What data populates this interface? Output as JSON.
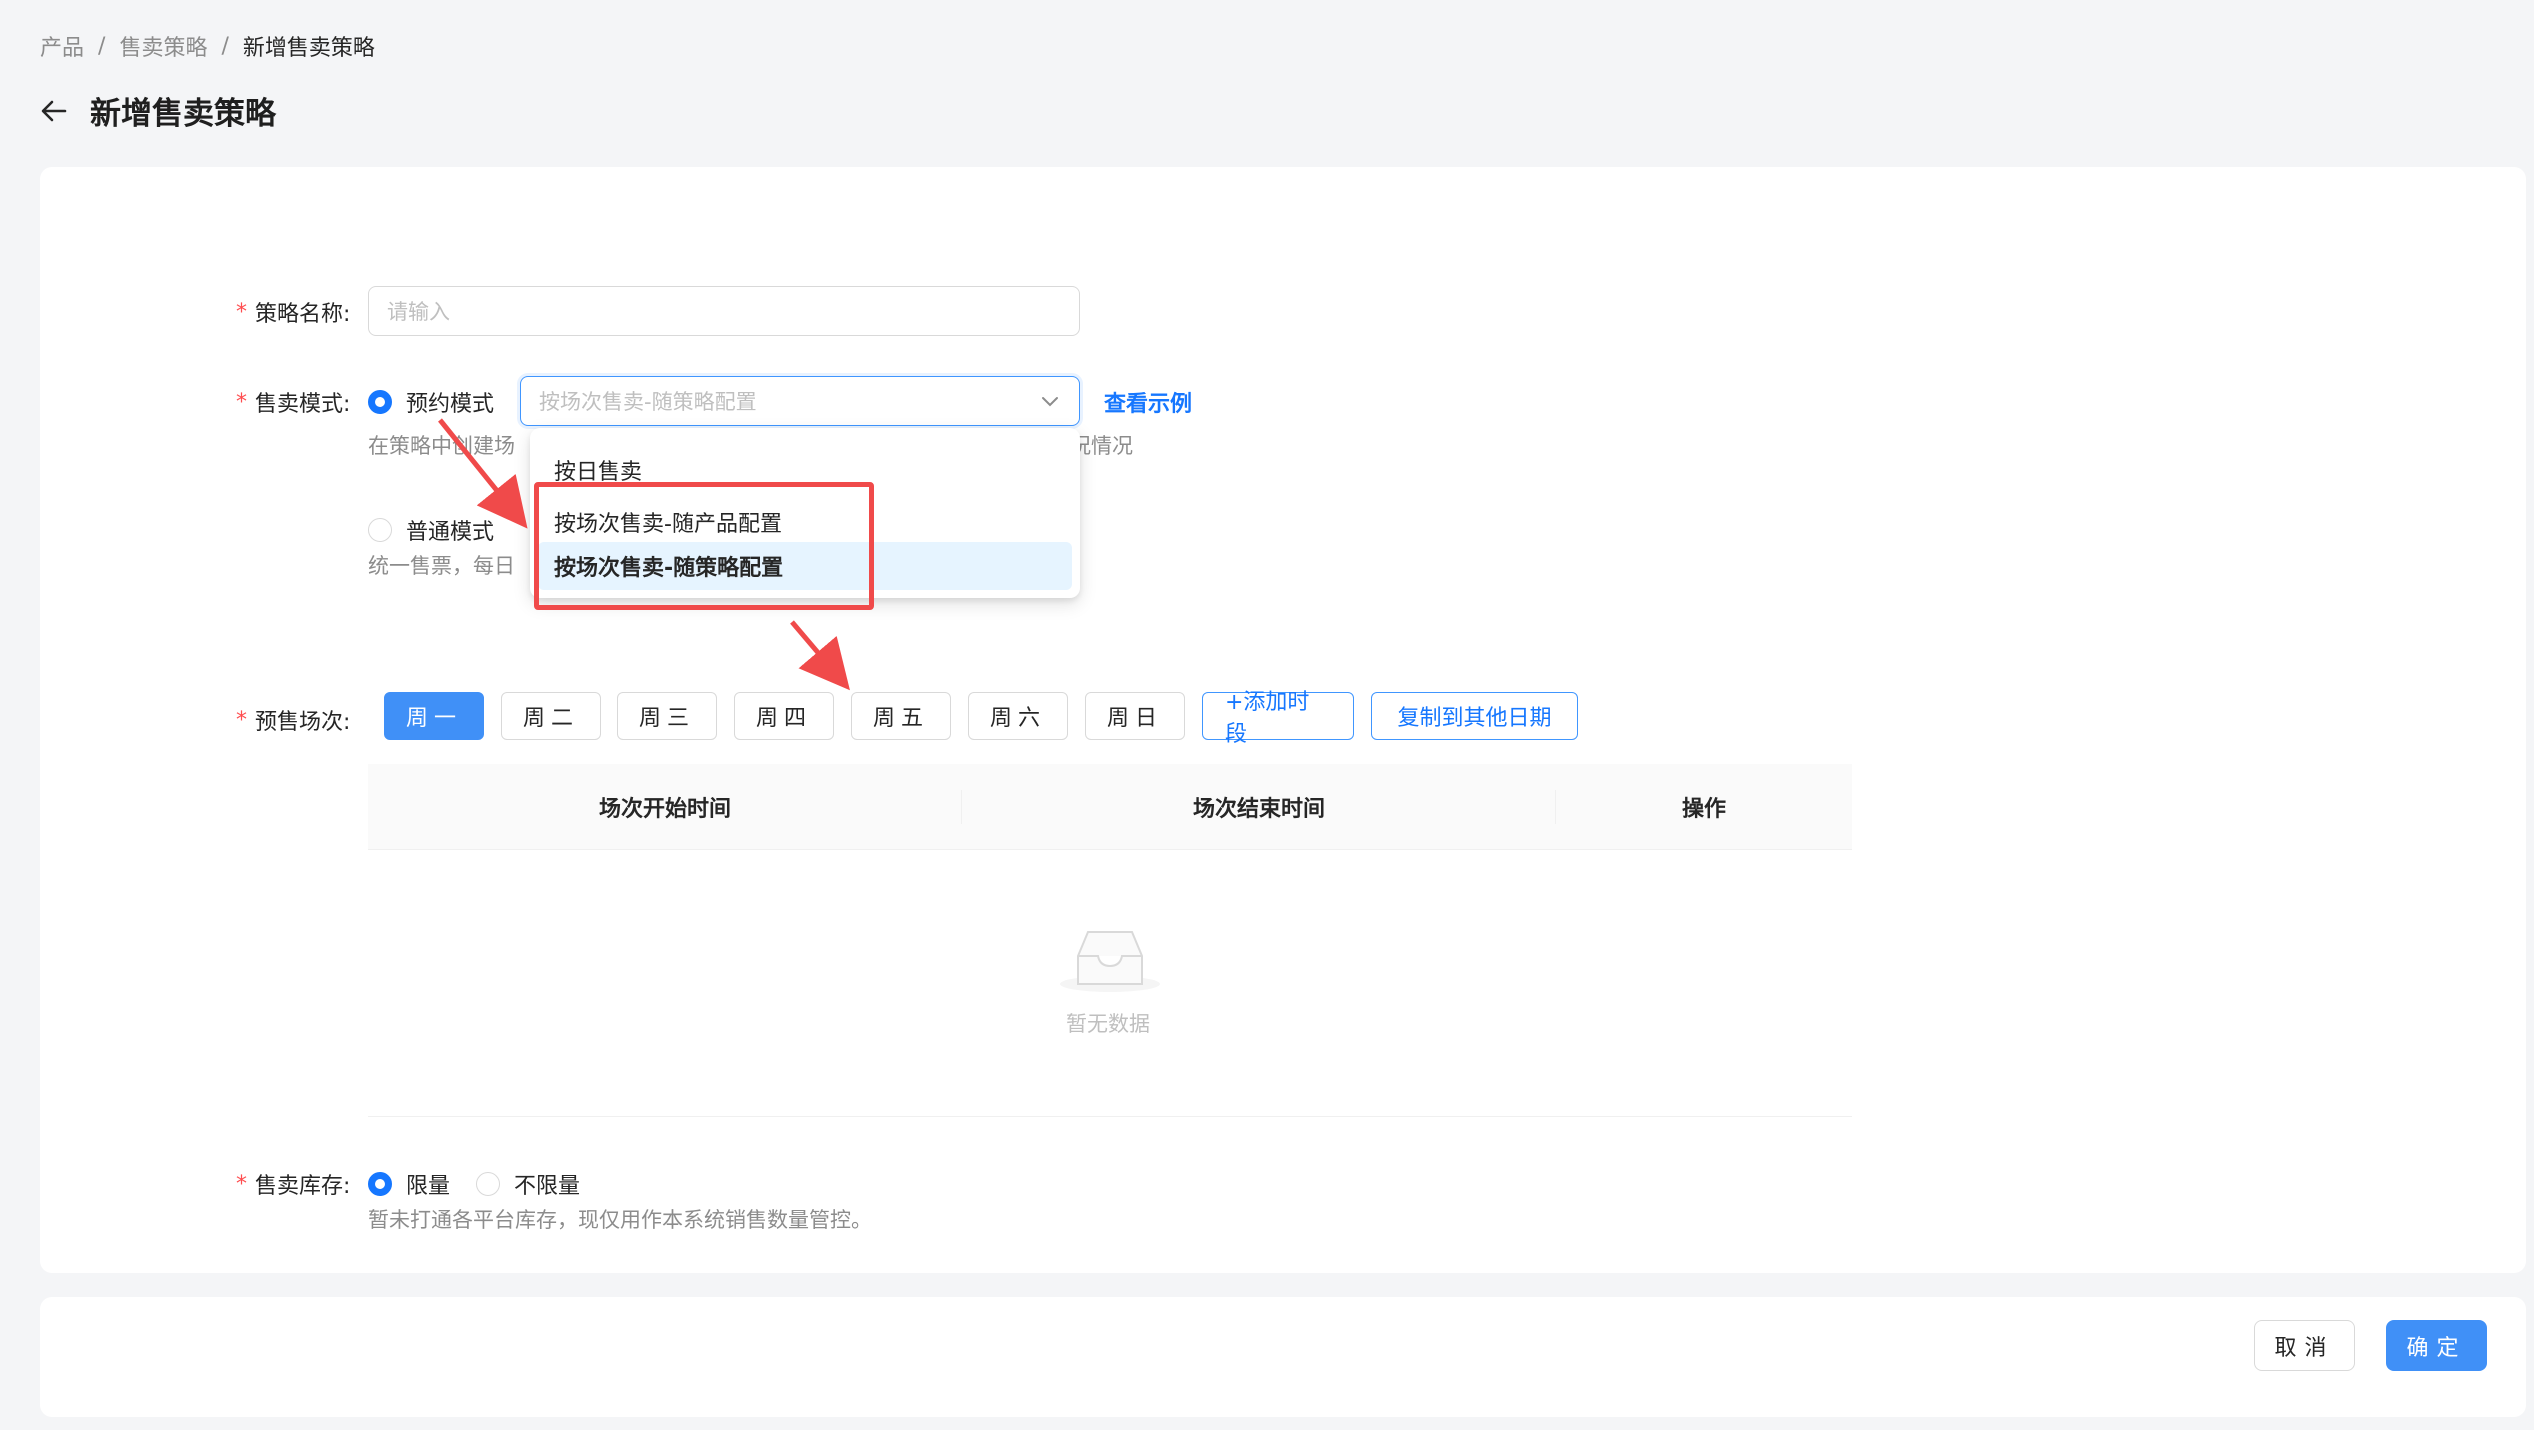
{
  "breadcrumb": {
    "item1": "产品",
    "item2": "售卖策略",
    "current": "新增售卖策略",
    "separator": "/"
  },
  "page": {
    "title": "新增售卖策略"
  },
  "form": {
    "required_mark": "*",
    "strategy_name": {
      "label": "策略名称:",
      "placeholder": "请输入"
    },
    "sale_mode": {
      "label": "售卖模式:",
      "option_reserve": "预约模式",
      "select_value": "按场次售卖-随策略配置",
      "view_example": "查看示例",
      "reserve_hint_left": "在策略中创建场",
      "reserve_hint_right": "况情况",
      "option_normal": "普通模式",
      "normal_hint": "统一售票，每日"
    },
    "presale": {
      "label": "预售场次:",
      "days": [
        "周一",
        "周二",
        "周三",
        "周四",
        "周五",
        "周六",
        "周日"
      ],
      "add_slot": "+添加时段",
      "copy_to_other": "复制到其他日期"
    },
    "table": {
      "col_start": "场次开始时间",
      "col_end": "场次结束时间",
      "col_action": "操作",
      "empty": "暂无数据"
    },
    "inventory": {
      "label": "售卖库存:",
      "option_limited": "限量",
      "option_unlimited": "不限量",
      "hint": "暂未打通各平台库存，现仅用作本系统销售数量管控。"
    }
  },
  "dropdown": {
    "options": [
      "按日售卖",
      "按场次售卖-随产品配置",
      "按场次售卖-随策略配置"
    ],
    "selected_index": 2
  },
  "footer": {
    "cancel": "取消",
    "confirm": "确定"
  },
  "colors": {
    "primary": "#4090f7",
    "link": "#1677ff",
    "required": "#ff4d4f",
    "annotation": "#f04a4a"
  }
}
